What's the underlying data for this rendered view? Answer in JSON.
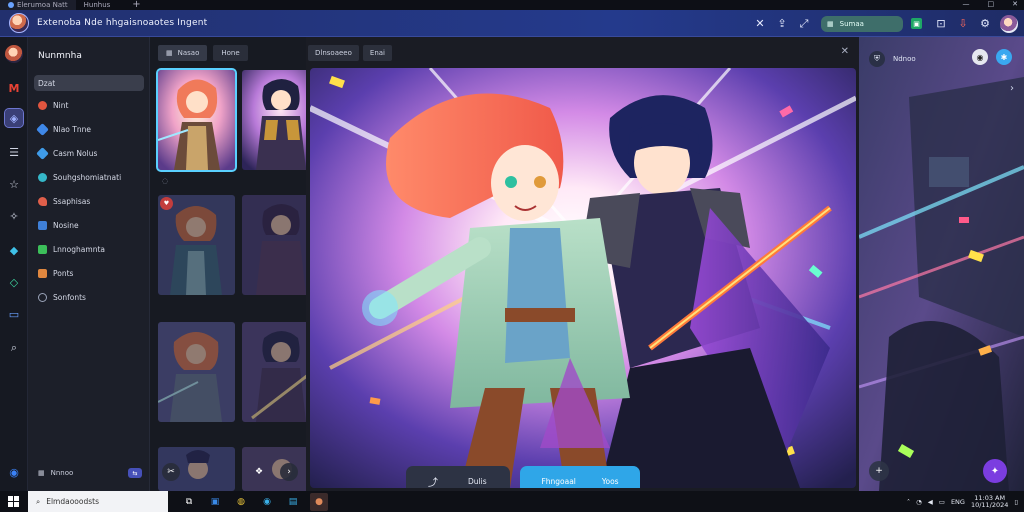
{
  "browser": {
    "tabs": [
      {
        "label": "Elerumoa Natt"
      },
      {
        "label": "Hunhus"
      }
    ],
    "new_tab": "+"
  },
  "header": {
    "title": "Extenoba Nde hhgaisnoaotes Ingent",
    "search_label": "Sumaa",
    "window_controls": [
      "—",
      "□",
      "✕"
    ]
  },
  "sidebar": {
    "title": "Nunmnha",
    "items": [
      {
        "label": "Dzat",
        "color": "#7f86a0"
      },
      {
        "label": "Nint",
        "color": "#e0553f"
      },
      {
        "label": "Nlao Tnne",
        "color": "#3f88e8"
      },
      {
        "label": "Casm Nolus",
        "color": "#3f9be8"
      },
      {
        "label": "Souhgshomiatnati",
        "color": "#35b7c8"
      },
      {
        "label": "Ssaphisas",
        "color": "#e05f4a"
      },
      {
        "label": "Nosine",
        "color": "#3f80d8"
      },
      {
        "label": "Lnnoghamnta",
        "color": "#3cbf5a"
      },
      {
        "label": "Ponts",
        "color": "#e0873f"
      },
      {
        "label": "Sonfonts",
        "color": "#9aa3b8"
      }
    ],
    "footer_label": "Nnnoo",
    "footer_badge": "⇆"
  },
  "thumbs": {
    "tabs": [
      "Nasao",
      "Hone"
    ]
  },
  "viewer": {
    "tabs": [
      "Dlnsoaeeo",
      "Enai"
    ],
    "close": "✕",
    "btn_left_label": "Dulis",
    "btn_right_labels": [
      "Fhngoaal",
      "Yoos"
    ]
  },
  "right_panel": {
    "label": "Ndnoo"
  },
  "taskbar": {
    "search_placeholder": "Elmdaooodsts",
    "tray_text": "ENG",
    "time": "11:03 AM",
    "date": "10/11/2024"
  }
}
